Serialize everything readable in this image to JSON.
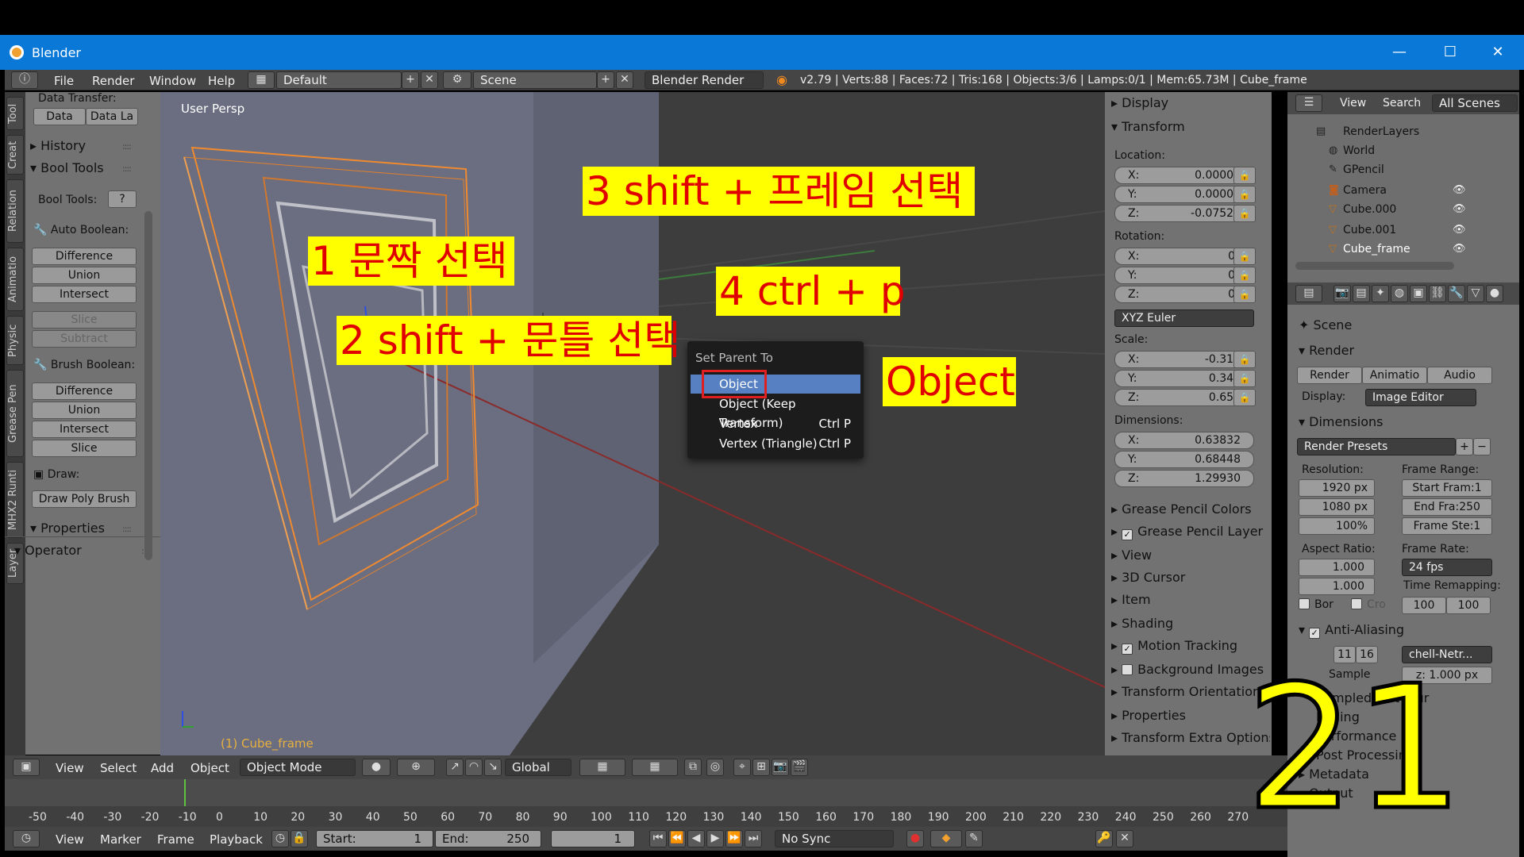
{
  "window": {
    "title": "Blender",
    "minimize": "—",
    "maximize": "☐",
    "close": "✕"
  },
  "menubar": {
    "items": [
      "File",
      "Render",
      "Window",
      "Help"
    ],
    "layout": "Default",
    "scene": "Scene",
    "engine": "Blender Render",
    "stats": "v2.79 | Verts:88 | Faces:72 | Tris:168 | Objects:3/6 | Lamps:0/1 | Mem:65.73M | Cube_frame"
  },
  "tabs": [
    "Tool",
    "Creat",
    "Relation",
    "Animatio",
    "Physic",
    "Grease Pen",
    "MHX2 Runti",
    "Layer"
  ],
  "toolshelf": {
    "data_transfer": "Data Transfer:",
    "data_btn": "Data",
    "data_la_btn": "Data La",
    "history": "History",
    "bool_tools": "Bool Tools",
    "bool_tools_label": "Bool Tools:",
    "auto_boolean": "Auto Boolean:",
    "auto_items": [
      "Difference",
      "Union",
      "Intersect"
    ],
    "auto_dim": [
      "Slice",
      "Subtract"
    ],
    "brush_boolean": "Brush Boolean:",
    "brush_items": [
      "Difference",
      "Union",
      "Intersect",
      "Slice"
    ],
    "draw": "Draw:",
    "draw_poly": "Draw Poly Brush",
    "properties": "Properties",
    "operator": "Operator"
  },
  "viewport": {
    "persp": "User Persp",
    "object_label": "(1) Cube_frame"
  },
  "annotations": {
    "a1": "1 문짝 선택",
    "a2": "2 shift + 문틀 선택",
    "a3": "3 shift + 프레임 선택",
    "a4": "4 ctrl + p",
    "a5": "Object",
    "big_number": "21"
  },
  "context_menu": {
    "title": "Set Parent To",
    "items": [
      {
        "label": "Object",
        "shortcut": ""
      },
      {
        "label": "Object (Keep Transform)",
        "shortcut": ""
      },
      {
        "label": "Vertex",
        "shortcut": "Ctrl P"
      },
      {
        "label": "Vertex (Triangle)",
        "shortcut": "Ctrl P"
      }
    ]
  },
  "npanel": {
    "display": "Display",
    "transform": "Transform",
    "location": "Location:",
    "loc": [
      {
        "k": "X:",
        "v": "0.00000"
      },
      {
        "k": "Y:",
        "v": "0.00000"
      },
      {
        "k": "Z:",
        "v": "-0.07527"
      }
    ],
    "rotation": "Rotation:",
    "rot": [
      {
        "k": "X:",
        "v": "0°"
      },
      {
        "k": "Y:",
        "v": "0°"
      },
      {
        "k": "Z:",
        "v": "0°"
      }
    ],
    "rot_mode": "XYZ Euler",
    "scale": "Scale:",
    "scl": [
      {
        "k": "X:",
        "v": "-0.319"
      },
      {
        "k": "Y:",
        "v": "0.342"
      },
      {
        "k": "Z:",
        "v": "0.650"
      }
    ],
    "dimensions": "Dimensions:",
    "dim": [
      {
        "k": "X:",
        "v": "0.63832"
      },
      {
        "k": "Y:",
        "v": "0.68448"
      },
      {
        "k": "Z:",
        "v": "1.29930"
      }
    ],
    "sections": [
      "Grease Pencil Colors",
      "Grease Pencil Layer",
      "View",
      "3D Cursor",
      "Item",
      "Shading",
      "Motion Tracking",
      "Background Images",
      "Transform Orientations",
      "Properties",
      "Transform Extra Options"
    ]
  },
  "outliner": {
    "view": "View",
    "search": "Search",
    "filter": "All Scenes",
    "rows": [
      "RenderLayers",
      "World",
      "GPencil",
      "Camera",
      "Cube.000",
      "Cube.001",
      "Cube_frame"
    ]
  },
  "properties": {
    "scene": "Scene",
    "render_panel": "Render",
    "render_btn": "Render",
    "anim_btn": "Animatio",
    "audio_btn": "Audio",
    "display_label": "Display:",
    "display_val": "Image Editor",
    "dimensions": "Dimensions",
    "presets": "Render Presets",
    "resolution": "Resolution:",
    "res_x": "1920 px",
    "res_y": "1080 px",
    "res_pct": "100%",
    "frame_range": "Frame Range:",
    "start": "Start Fram:1",
    "end": "End Fra:250",
    "step": "Frame Ste:1",
    "aspect": "Aspect Ratio:",
    "asp_x": "1.000",
    "asp_y": "1.000",
    "frame_rate": "Frame Rate:",
    "fps": "24 fps",
    "remap": "Time Remapping:",
    "remap_old": "100",
    "remap_new": "100",
    "border": "Bor",
    "crop": "Cro",
    "anti_aliasing": "Anti-Aliasing",
    "aa_11": "11",
    "aa_16": "16",
    "filter": "chell-Netr...",
    "sample": "Sample",
    "size": "z: 1.000 px",
    "sampled_motion": "Sampled Mot",
    "blur": "Blur",
    "shading": "hading",
    "performance": "Performance",
    "post": "Post Processing",
    "metadata": "Metadata",
    "output": "Output"
  },
  "viewport_header": {
    "view": "View",
    "select": "Select",
    "add": "Add",
    "object": "Object",
    "mode": "Object Mode",
    "orientation": "Global"
  },
  "timeline": {
    "ticks": [
      "-50",
      "-40",
      "-30",
      "-20",
      "-10",
      "0",
      "10",
      "20",
      "30",
      "40",
      "50",
      "60",
      "70",
      "80",
      "90",
      "100",
      "110",
      "120",
      "130",
      "140",
      "150",
      "160",
      "170",
      "180",
      "190",
      "200",
      "210",
      "220",
      "230",
      "240",
      "250",
      "260",
      "270"
    ],
    "current_frame_marker": "0",
    "view": "View",
    "marker": "Marker",
    "frame": "Frame",
    "playback": "Playback",
    "start_label": "Start:",
    "start_val": "1",
    "end_label": "End:",
    "end_val": "250",
    "current": "1",
    "sync": "No Sync"
  },
  "colors": {
    "annotation_bg": "#ffff00",
    "annotation_text": "#e00000",
    "highlight": "#5680c2",
    "redbox": "#e02020",
    "title_bar": "#0a78d7"
  }
}
